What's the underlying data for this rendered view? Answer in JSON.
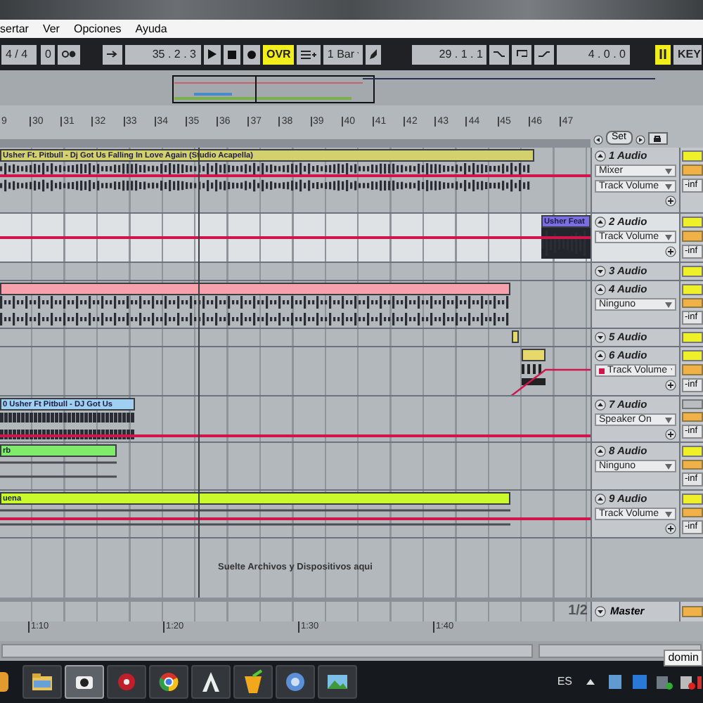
{
  "menu": [
    "sertar",
    "Ver",
    "Opciones",
    "Ayuda"
  ],
  "transport": {
    "signature": "4 / 4",
    "count_in": "0",
    "position": "35 . 2 . 3",
    "ovr": {
      "label": "OVR",
      "on": true
    },
    "quantize": "1 Bar",
    "loop_start": "29 . 1 . 1",
    "loop_length": "4 . 0 . 0",
    "key": "KEY"
  },
  "ruler": [
    "9",
    "30",
    "31",
    "32",
    "33",
    "34",
    "35",
    "36",
    "37",
    "38",
    "39",
    "40",
    "41",
    "42",
    "43",
    "44",
    "45",
    "46",
    "47"
  ],
  "set_label": "Set",
  "tracks": [
    {
      "name": "1 Audio",
      "collapsed": false,
      "selected": false,
      "active": true,
      "choosers": [
        {
          "label": "Mixer",
          "automated": false
        },
        {
          "label": "Track Volume",
          "automated": false
        }
      ],
      "add_button": true,
      "readout": "-inf",
      "clip": {
        "title": "Usher Ft. Pitbull - Dj Got Us Falling In Love Again (Studio Acapella)",
        "color": "#d3d06e"
      }
    },
    {
      "name": "2 Audio",
      "collapsed": false,
      "selected": true,
      "active": true,
      "choosers": [
        {
          "label": "Track Volume",
          "automated": false
        }
      ],
      "add_button": true,
      "readout": "-inf",
      "clip": {
        "title": "Usher Feat",
        "color": "#7a6ee0"
      }
    },
    {
      "name": "3 Audio",
      "collapsed": true,
      "selected": false,
      "active": true,
      "add_button": false
    },
    {
      "name": "4 Audio",
      "collapsed": false,
      "selected": false,
      "active": true,
      "choosers": [
        {
          "label": "Ninguno",
          "automated": false
        }
      ],
      "add_button": false,
      "readout": "-inf",
      "clip": {
        "color": "#f7a1ad"
      }
    },
    {
      "name": "5 Audio",
      "collapsed": true,
      "selected": false,
      "active": true,
      "add_button": false,
      "clip": {
        "color": "#e6d86a"
      }
    },
    {
      "name": "6 Audio",
      "collapsed": false,
      "selected": false,
      "active": true,
      "choosers": [
        {
          "label": "Track Volume",
          "automated": true
        }
      ],
      "add_button": true,
      "readout": "-inf",
      "clip": {
        "color": "#e6d86a"
      }
    },
    {
      "name": "7 Audio",
      "collapsed": false,
      "selected": false,
      "active": false,
      "choosers": [
        {
          "label": "Speaker On",
          "automated": false
        }
      ],
      "add_button": true,
      "readout": "-inf",
      "clip": {
        "title": "0 Usher Ft Pitbull - DJ Got Us",
        "color": "#9fd0f2"
      }
    },
    {
      "name": "8 Audio",
      "collapsed": false,
      "selected": false,
      "active": true,
      "choosers": [
        {
          "label": "Ninguno",
          "automated": false
        }
      ],
      "add_button": false,
      "readout": "-inf",
      "clip": {
        "title": "rb",
        "color": "#80ea6a"
      }
    },
    {
      "name": "9 Audio",
      "collapsed": false,
      "selected": false,
      "active": true,
      "choosers": [
        {
          "label": "Track Volume",
          "automated": false
        }
      ],
      "add_button": true,
      "readout": "-inf",
      "clip": {
        "title": "uena",
        "color": "#c9fb2c"
      }
    }
  ],
  "drop_hint": "Suelte Archivos y Dispositivos aqui",
  "master": {
    "name": "Master",
    "page": "1/2"
  },
  "time_ruler": [
    "1:10",
    "1:20",
    "1:30",
    "1:40"
  ],
  "taskbar": {
    "apps": [
      {
        "kind": "folder",
        "selected": false
      },
      {
        "kind": "camera",
        "selected": true
      },
      {
        "kind": "disc",
        "selected": false
      },
      {
        "kind": "globe",
        "selected": false
      },
      {
        "kind": "peak",
        "selected": false
      },
      {
        "kind": "fruit",
        "selected": false
      },
      {
        "kind": "music",
        "selected": false
      },
      {
        "kind": "landscape",
        "selected": false
      }
    ],
    "language": "ES",
    "tooltip": "domin"
  }
}
